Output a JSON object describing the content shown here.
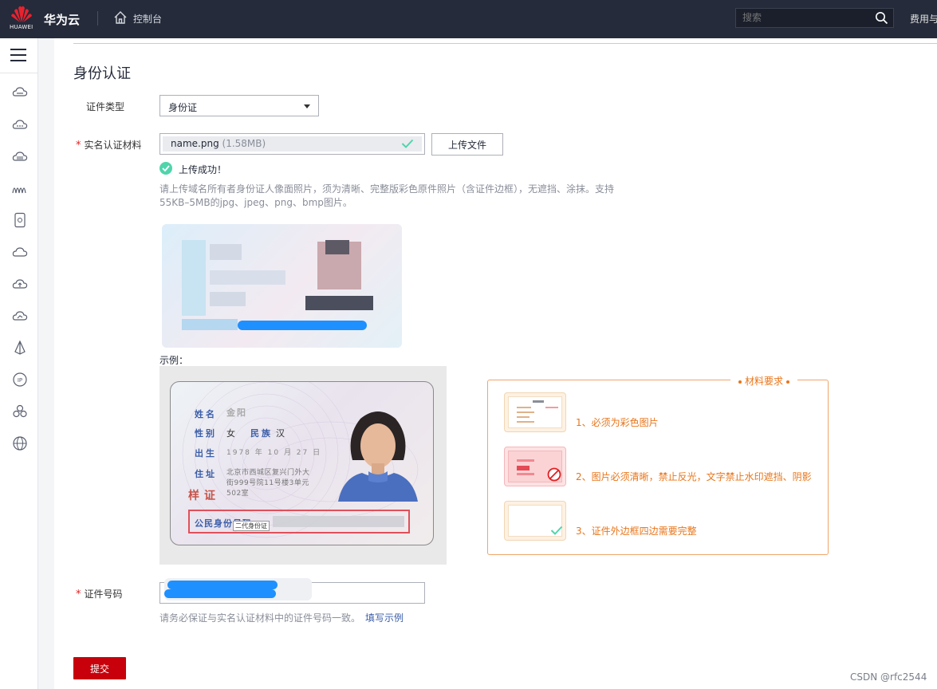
{
  "header": {
    "logo_text": "HUAWEI",
    "brand": "华为云",
    "console": "控制台",
    "search_placeholder": "搜索",
    "billing": "费用与"
  },
  "sidebar": {
    "icons": [
      "menu-icon",
      "cloud-server-icon",
      "cloud-more-icon",
      "cloud-db-icon",
      "cdn-wave-icon",
      "storage-icon",
      "cloud-icon",
      "cloud-upload-icon",
      "cloud-monitor-icon",
      "sail-icon",
      "ip-icon",
      "cluster-icon",
      "globe-icon"
    ]
  },
  "form": {
    "title": "身份认证",
    "cert_type_label": "证件类型",
    "cert_type_value": "身份证",
    "material_label": "实名认证材料",
    "required_mark": "*",
    "file_name": "name.png",
    "file_size": "(1.58MB)",
    "upload_button": "上传文件",
    "upload_success": "上传成功！",
    "help_line1": "请上传域名所有者身份证人像面照片，须为清晰、完整版彩色原件照片（含证件边框），无遮挡、涂抹。支持",
    "help_line2": "55KB–5MB的jpg、jpeg、png、bmp图片。",
    "example_label": "示例：",
    "id_number_label": "证件号码",
    "id_number_hint": "请务必保证与实名认证材料中的证件号码一致。",
    "id_number_link": "填写示例",
    "submit": "提交"
  },
  "sample_card": {
    "name_label": "姓名",
    "name_value": "金阳",
    "sex_label": "性别",
    "sex_value": "女",
    "ethnic_label": "民族",
    "ethnic_value": "汉",
    "birth_label": "出生",
    "birth_value": "1978 年 10 月 27 日",
    "addr_label": "住址",
    "addr_line1": "北京市西城区复兴门外大",
    "addr_line2": "街999号院11号楼3单元",
    "addr_line3": "502室",
    "stamp": "样证",
    "id_label": "公民身份号码",
    "tooltip": "二代身份证"
  },
  "requirements": {
    "title": "材料要求",
    "items": [
      "1、必须为彩色图片",
      "2、图片必须清晰，禁止反光，文字禁止水印遮挡、阴影",
      "3、证件外边框四边需要完整"
    ]
  },
  "watermark": "CSDN @rfc2544",
  "colors": {
    "topbar": "#252b3a",
    "primary_red": "#c7000b",
    "success_green": "#50d4ab",
    "orange": "#e8751a",
    "link_blue": "#3b5ea8",
    "mask_blue": "#1e90ff"
  }
}
